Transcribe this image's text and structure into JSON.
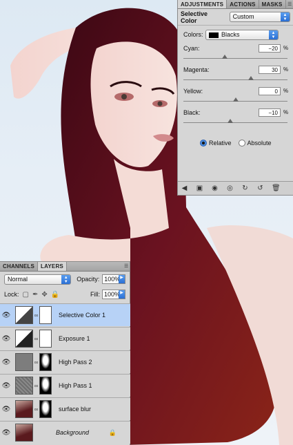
{
  "adjustments_panel": {
    "tabs": [
      "ADJUSTMENTS",
      "ACTIONS",
      "MASKS"
    ],
    "title": "Selective Color",
    "preset_value": "Custom",
    "colors_label": "Colors:",
    "colors_value": "Blacks",
    "sliders": [
      {
        "label": "Cyan:",
        "value": "−20",
        "unit": "%",
        "level": -20
      },
      {
        "label": "Magenta:",
        "value": "30",
        "unit": "%",
        "level": 30
      },
      {
        "label": "Yellow:",
        "value": "0",
        "unit": "%",
        "level": 0
      },
      {
        "label": "Black:",
        "value": "−10",
        "unit": "%",
        "level": -10
      }
    ],
    "relative_label": "Relative",
    "absolute_label": "Absolute",
    "selected_method": "Relative",
    "footer_icons": [
      "back-arrow-icon",
      "fit-screen-icon",
      "clip-layer-icon",
      "visibility-icon",
      "previous-state-icon",
      "reset-icon",
      "trash-icon"
    ]
  },
  "layers_panel": {
    "tabs": [
      "CHANNELS",
      "LAYERS"
    ],
    "blend_mode": "Normal",
    "opacity_label": "Opacity:",
    "opacity_value": "100%",
    "lock_label": "Lock:",
    "fill_label": "Fill:",
    "fill_value": "100%",
    "layers": [
      {
        "name": "Selective Color 1",
        "selected": true
      },
      {
        "name": "Exposure 1",
        "selected": false
      },
      {
        "name": "High Pass 2",
        "selected": false
      },
      {
        "name": "High Pass 1",
        "selected": false
      },
      {
        "name": "surface blur",
        "selected": false
      },
      {
        "name": "Background",
        "selected": false,
        "locked": true
      }
    ]
  },
  "colors": {
    "selection": "#b7d2f6",
    "panel": "#d6d6d6",
    "accent": "#2a6fd4",
    "hair": "#5a1020"
  }
}
